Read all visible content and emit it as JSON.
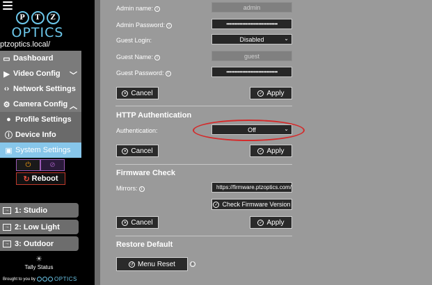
{
  "sidebar": {
    "logo_letters": [
      "P",
      "T",
      "Z"
    ],
    "logo_text": "OPTICS",
    "host": "ptzoptics.local/",
    "menu": [
      {
        "label": "Dashboard",
        "icon": "camera-icon"
      },
      {
        "label": "Video Config",
        "icon": "video-icon"
      },
      {
        "label": "Network Settings",
        "icon": "network-icon"
      },
      {
        "label": "Camera Config",
        "icon": "gear-icon"
      },
      {
        "label": "Profile Settings",
        "icon": "user-icon"
      },
      {
        "label": "Device Info",
        "icon": "info-icon"
      },
      {
        "label": "System Settings",
        "icon": "system-icon"
      }
    ],
    "reboot_label": "Reboot",
    "presets": [
      "1: Studio",
      "2: Low Light",
      "3: Outdoor"
    ],
    "tally_label": "Tally Status",
    "brought_label": "Brought to you by",
    "brought_brand": "OPTICS"
  },
  "content": {
    "admin_name_label": "Admin name:",
    "admin_name_value": "admin",
    "admin_password_label": "Admin Password:",
    "admin_password_value": "••••••••••••••••••••••••••••••••",
    "guest_login_label": "Guest Login:",
    "guest_login_value": "Disabled",
    "guest_name_label": "Guest Name:",
    "guest_name_value": "guest",
    "guest_password_label": "Guest Password:",
    "guest_password_value": "••••••••••••••••••••••••••••••••",
    "cancel_label": "Cancel",
    "apply_label": "Apply",
    "http_title": "HTTP Authentication",
    "auth_label": "Authentication:",
    "auth_value": "Off",
    "firmware_title": "Firmware Check",
    "mirrors_label": "Mirrors:",
    "mirrors_value": "https://firmware.ptzoptics.com/",
    "check_firmware_label": "Check Firmware Version",
    "restore_title": "Restore Default",
    "menu_reset_label": "Menu Reset"
  },
  "colors": {
    "accent": "#87c6ea",
    "annotation": "#d42a2a"
  }
}
